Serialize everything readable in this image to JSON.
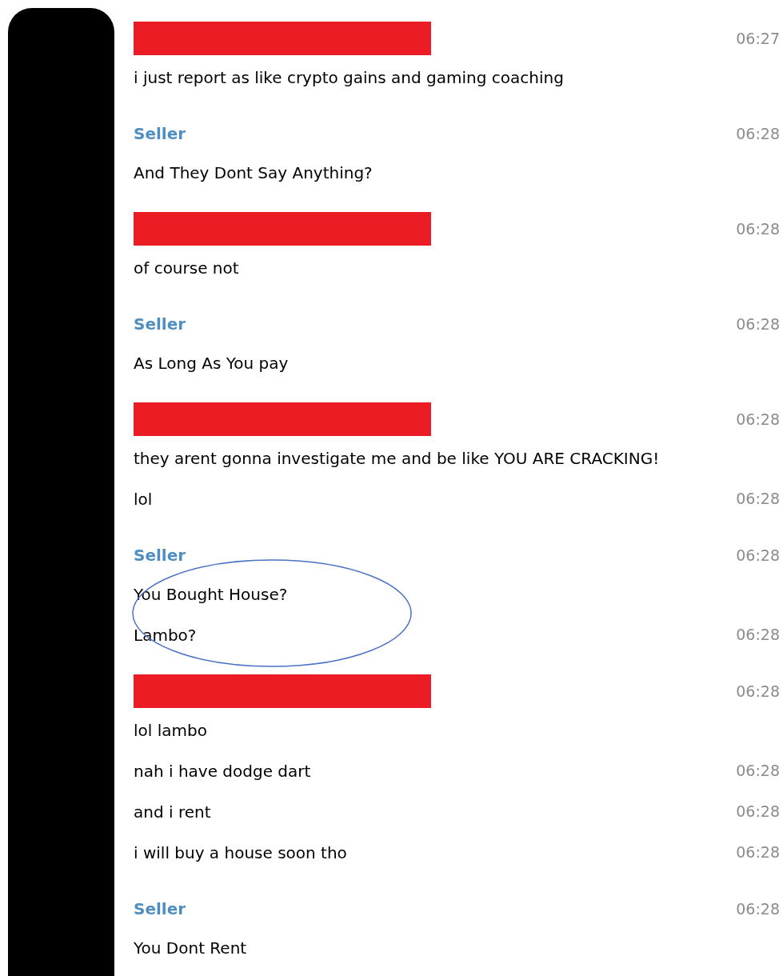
{
  "groups": [
    {
      "sender": {
        "kind": "redacted"
      },
      "time": "06:27",
      "messages": [
        {
          "text": "i just report as like crypto gains and gaming coaching"
        }
      ]
    },
    {
      "sender": {
        "kind": "name",
        "name": "Seller"
      },
      "time": "06:28",
      "messages": [
        {
          "text": "And They Dont Say Anything?"
        }
      ]
    },
    {
      "sender": {
        "kind": "redacted"
      },
      "time": "06:28",
      "messages": [
        {
          "text": "of course not"
        }
      ]
    },
    {
      "sender": {
        "kind": "name",
        "name": "Seller"
      },
      "time": "06:28",
      "messages": [
        {
          "text": "As Long As You pay"
        }
      ]
    },
    {
      "sender": {
        "kind": "redacted"
      },
      "time": "06:28",
      "messages": [
        {
          "text": "they arent gonna investigate me and be like YOU ARE CRACKING!"
        },
        {
          "text": "lol",
          "time": "06:28"
        }
      ]
    },
    {
      "sender": {
        "kind": "name",
        "name": "Seller"
      },
      "time": "06:28",
      "circled": true,
      "messages": [
        {
          "text": "You Bought House?"
        },
        {
          "text": "Lambo?",
          "time": "06:28"
        }
      ]
    },
    {
      "sender": {
        "kind": "redacted"
      },
      "time": "06:28",
      "messages": [
        {
          "text": "lol lambo"
        },
        {
          "text": "nah i have dodge dart",
          "time": "06:28"
        },
        {
          "text": "and i rent",
          "time": "06:28"
        },
        {
          "text": "i will buy a house soon tho",
          "time": "06:28"
        }
      ]
    },
    {
      "sender": {
        "kind": "name",
        "name": "Seller"
      },
      "time": "06:28",
      "messages": [
        {
          "text": "You Dont Rent"
        }
      ]
    }
  ]
}
